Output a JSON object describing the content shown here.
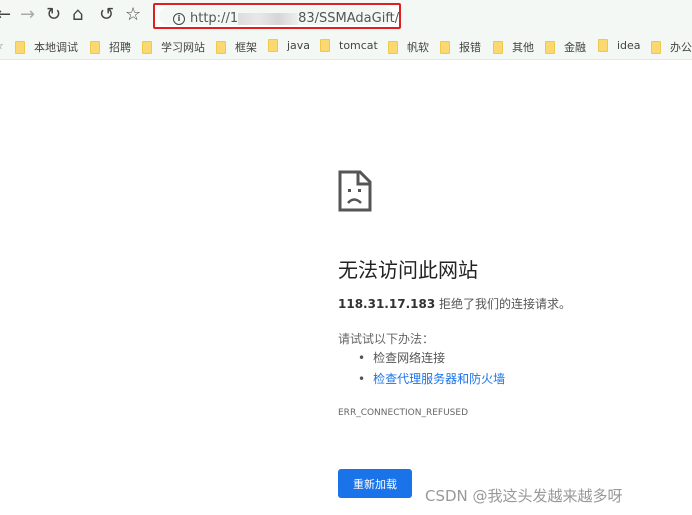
{
  "toolbar": {
    "back_icon": "back-arrow-icon",
    "forward_icon": "forward-arrow-icon",
    "reload_icon": "reload-icon",
    "home_icon": "home-icon",
    "undo_icon": "undo-icon",
    "star_icon": "star-icon",
    "url_prefix": "http://1",
    "url_suffix": "83/SSMAdaGift/"
  },
  "bookmarks": [
    "本地调试",
    "招聘",
    "学习网站",
    "框架",
    "java",
    "tomcat",
    "帆软",
    "报错",
    "其他",
    "金融",
    "idea",
    "办公"
  ],
  "error": {
    "icon": "sad-page-icon",
    "title": "无法访问此网站",
    "host": "118.31.17.183",
    "message": " 拒绝了我们的连接请求。",
    "try_label": "请试试以下办法：",
    "suggestions": [
      "检查网络连接",
      "检查代理服务器和防火墙"
    ],
    "code": "ERR_CONNECTION_REFUSED",
    "reload_label": "重新加载"
  },
  "watermark": "CSDN @我这头发越来越多呀",
  "colors": {
    "accent": "#1a73e8",
    "highlight_border": "#e02020"
  }
}
